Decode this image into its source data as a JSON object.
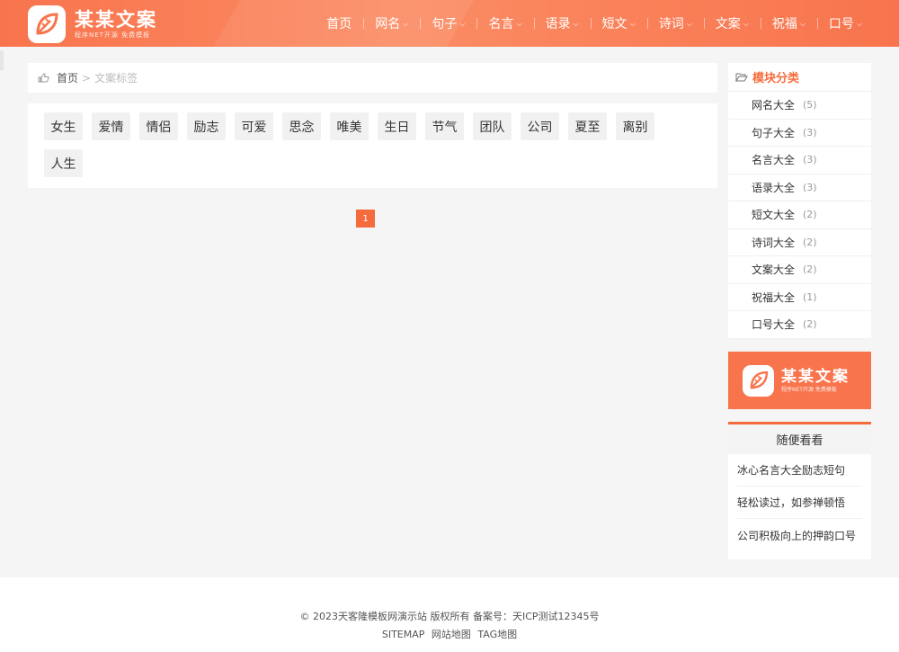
{
  "header": {
    "logo_title": "某某文案",
    "logo_sub": "程序NET开源 免费模板",
    "nav": [
      {
        "label": "首页",
        "dropdown": false
      },
      {
        "label": "网名",
        "dropdown": true
      },
      {
        "label": "句子",
        "dropdown": true
      },
      {
        "label": "名言",
        "dropdown": true
      },
      {
        "label": "语录",
        "dropdown": true
      },
      {
        "label": "短文",
        "dropdown": true
      },
      {
        "label": "诗词",
        "dropdown": true
      },
      {
        "label": "文案",
        "dropdown": true
      },
      {
        "label": "祝福",
        "dropdown": true
      },
      {
        "label": "口号",
        "dropdown": true
      }
    ],
    "caret": "⌵"
  },
  "breadcrumb": {
    "home": "首页",
    "sep": ">",
    "current": "文案标签",
    "icon": "thumbs-up-icon"
  },
  "tags": [
    "女生",
    "爱情",
    "情侣",
    "励志",
    "可爱",
    "思念",
    "唯美",
    "生日",
    "节气",
    "团队",
    "公司",
    "夏至",
    "离别",
    "人生"
  ],
  "pager": {
    "current": "1"
  },
  "sidebar": {
    "category_title": "模块分类",
    "category_icon": "folder-open-icon",
    "categories": [
      {
        "label": "网名大全",
        "count": "(5)"
      },
      {
        "label": "句子大全",
        "count": "(3)"
      },
      {
        "label": "名言大全",
        "count": "(3)"
      },
      {
        "label": "语录大全",
        "count": "(3)"
      },
      {
        "label": "短文大全",
        "count": "(2)"
      },
      {
        "label": "诗词大全",
        "count": "(2)"
      },
      {
        "label": "文案大全",
        "count": "(2)"
      },
      {
        "label": "祝福大全",
        "count": "(1)"
      },
      {
        "label": "口号大全",
        "count": "(2)"
      }
    ],
    "banner_title": "某某文案",
    "banner_sub": "程序NET开源 免费模板",
    "random_title": "随便看看",
    "random_items": [
      "冰心名言大全励志短句",
      "轻松读过，如参禅顿悟",
      "公司积极向上的押韵口号"
    ]
  },
  "footer": {
    "copyright": "© 2023天客隆模板网演示站 版权所有 备案号：天ICP测试12345号",
    "links": [
      "SITEMAP",
      "网站地图",
      "TAG地图"
    ]
  },
  "colors": {
    "accent": "#f56b3b",
    "header": "#f8744d",
    "background": "#f5f5f5"
  }
}
